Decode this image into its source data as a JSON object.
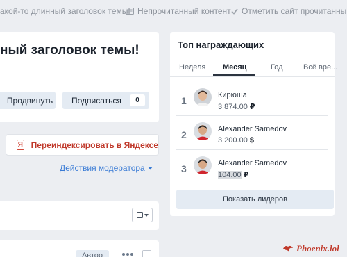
{
  "topbar": {
    "breadcrumb_title": "акой-то длинный заголовок темы!",
    "unread_label": "Непрочитанный контент",
    "mark_read_label": "Отметить сайт прочитанным"
  },
  "thread": {
    "title": "ный заголовок темы!",
    "promote_label": "Продвинуть",
    "subscribe_label": "Подписаться",
    "subscribe_count": "0",
    "yandex_logo": "Я",
    "reindex_label": "Переиндексировать в Яндексе",
    "moderator_actions_label": "Действия модератора"
  },
  "post": {
    "author_badge": "Автор"
  },
  "widget": {
    "title": "Топ награждающих",
    "tabs": [
      {
        "label": "Неделя",
        "active": false
      },
      {
        "label": "Месяц",
        "active": true
      },
      {
        "label": "Год",
        "active": false
      },
      {
        "label": "Всё вре...",
        "active": false
      }
    ],
    "leaders": [
      {
        "rank": "1",
        "name": "Кирюша",
        "amount": "3 874.00",
        "currency": "₽"
      },
      {
        "rank": "2",
        "name": "Alexander Samedov",
        "amount": "3 200.00",
        "currency": "$"
      },
      {
        "rank": "3",
        "name": "Alexander Samedov",
        "amount": "104.00",
        "currency": "₽"
      }
    ],
    "show_leaders_label": "Показать лидеров"
  },
  "brand": {
    "text": "Phoenix.lol"
  },
  "colors": {
    "accent_link": "#3a7bd5",
    "yandex_red": "#c0392b",
    "button_bg": "#e4ebf3"
  }
}
